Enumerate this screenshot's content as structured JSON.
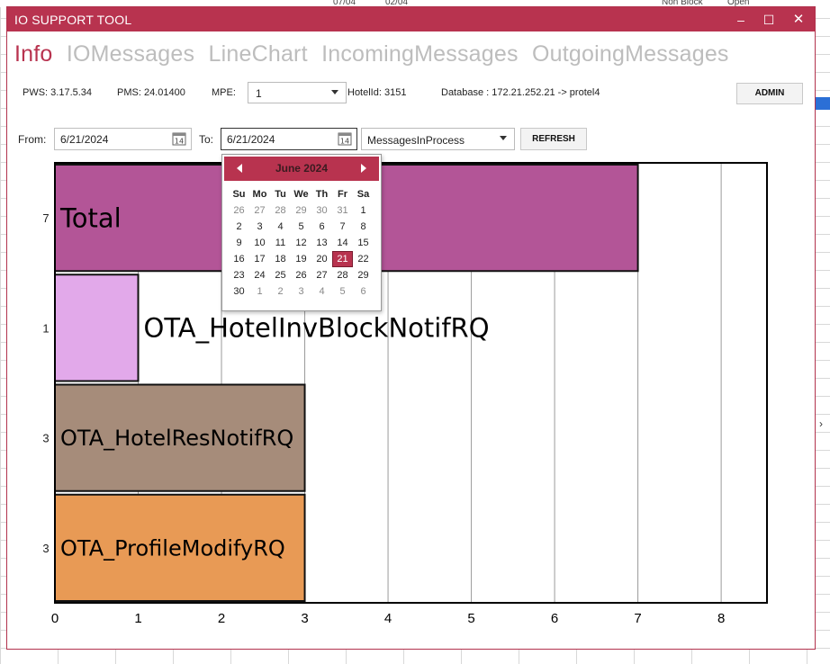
{
  "background": {
    "top_labels": [
      "07/04",
      "02/04",
      "Non Block",
      "Open"
    ]
  },
  "window": {
    "title": "IO SUPPORT TOOL",
    "minimize_glyph": "–",
    "maximize_glyph": "☐",
    "close_glyph": "✕"
  },
  "tabs": [
    {
      "label": "Info",
      "active": true
    },
    {
      "label": "IOMessages",
      "active": false
    },
    {
      "label": "LineChart",
      "active": false
    },
    {
      "label": "IncomingMessages",
      "active": false
    },
    {
      "label": "OutgoingMessages",
      "active": false
    }
  ],
  "info": {
    "pws": "PWS: 3.17.5.34",
    "pms": "PMS: 24.01400",
    "mpe_label": "MPE:",
    "mpe_value": "1",
    "hotel": "HotelId: 3151",
    "database": "Database : 172.21.252.21 -> protel4",
    "admin_label": "ADMIN"
  },
  "filter": {
    "from_label": "From:",
    "from_value": "6/21/2024",
    "to_label": "To:",
    "to_value": "6/21/2024",
    "type_value": "MessagesInProcess",
    "refresh_label": "REFRESH"
  },
  "calendar": {
    "month": "June 2024",
    "weekdays": [
      "Su",
      "Mo",
      "Tu",
      "We",
      "Th",
      "Fr",
      "Sa"
    ],
    "weeks": [
      [
        "26",
        "27",
        "28",
        "29",
        "30",
        "31",
        "1"
      ],
      [
        "2",
        "3",
        "4",
        "5",
        "6",
        "7",
        "8"
      ],
      [
        "9",
        "10",
        "11",
        "12",
        "13",
        "14",
        "15"
      ],
      [
        "16",
        "17",
        "18",
        "19",
        "20",
        "21",
        "22"
      ],
      [
        "23",
        "24",
        "25",
        "26",
        "27",
        "28",
        "29"
      ],
      [
        "30",
        "1",
        "2",
        "3",
        "4",
        "5",
        "6"
      ]
    ],
    "selected": "21",
    "accent": "#b8334f"
  },
  "chart_data": {
    "type": "bar",
    "orientation": "horizontal",
    "categories": [
      "Total",
      "OTA_HotelInvBlockNotifRQ",
      "OTA_HotelResNotifRQ",
      "OTA_ProfileModifyRQ"
    ],
    "values": [
      7,
      1,
      3,
      3
    ],
    "colors": [
      "#b35597",
      "#e2a9ea",
      "#a68c7a",
      "#e89a55"
    ],
    "xlim": [
      0,
      8.55
    ],
    "xticks": [
      0,
      1,
      2,
      3,
      4,
      5,
      6,
      7,
      8
    ],
    "grid": true
  }
}
